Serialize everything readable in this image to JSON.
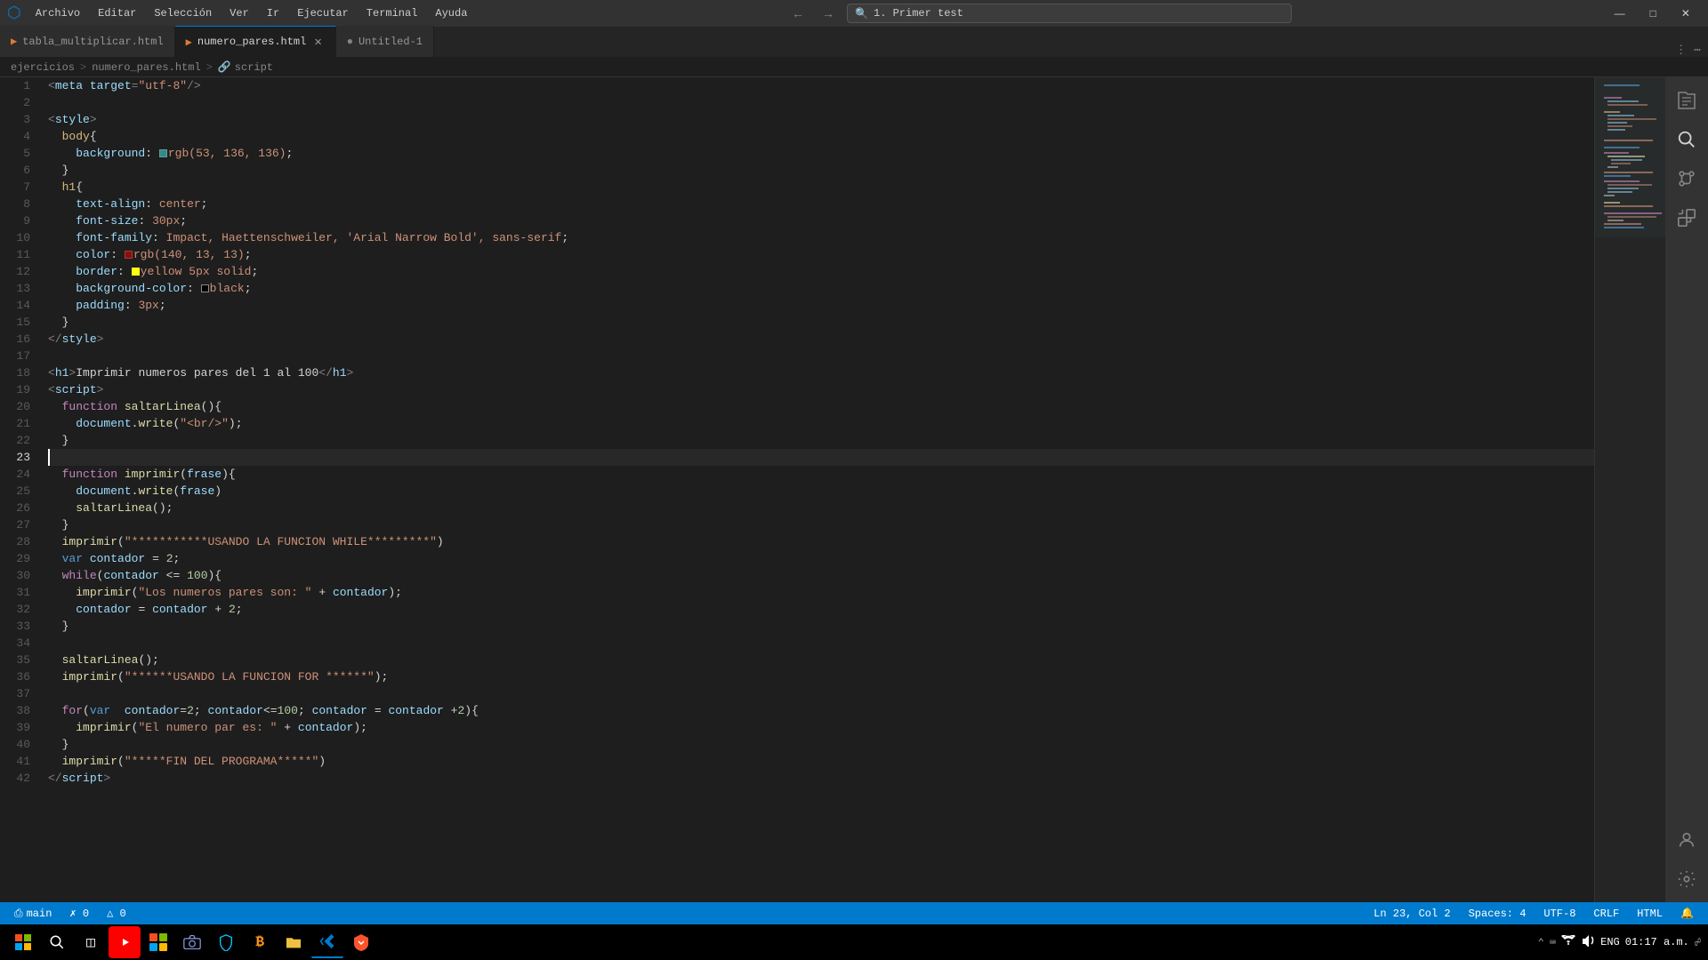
{
  "titlebar": {
    "menu": [
      "Archivo",
      "Editar",
      "Selección",
      "Ver",
      "Ir",
      "Ejecutar",
      "Terminal",
      "Ayuda"
    ],
    "search": "1. Primer test",
    "window_buttons": [
      "—",
      "⬜",
      "✕"
    ]
  },
  "tabs": [
    {
      "id": "tab1",
      "label": "tabla_multiplicar.html",
      "active": false,
      "modified": false
    },
    {
      "id": "tab2",
      "label": "numero_pares.html",
      "active": true,
      "modified": false
    },
    {
      "id": "tab3",
      "label": "Untitled-1",
      "active": false,
      "modified": true
    }
  ],
  "breadcrumb": [
    "ejercicios",
    "numero_pares.html",
    "script"
  ],
  "code_lines": [
    {
      "n": 1,
      "content": "meta_target"
    },
    {
      "n": 2,
      "content": "empty"
    },
    {
      "n": 3,
      "content": "style_open"
    },
    {
      "n": 4,
      "content": "body_open"
    },
    {
      "n": 5,
      "content": "background"
    },
    {
      "n": 6,
      "content": "close_brace"
    },
    {
      "n": 7,
      "content": "h1_open"
    },
    {
      "n": 8,
      "content": "text_align"
    },
    {
      "n": 9,
      "content": "font_size"
    },
    {
      "n": 10,
      "content": "font_family"
    },
    {
      "n": 11,
      "content": "color_line"
    },
    {
      "n": 12,
      "content": "border_line"
    },
    {
      "n": 13,
      "content": "bg_color"
    },
    {
      "n": 14,
      "content": "padding"
    },
    {
      "n": 15,
      "content": "close_brace"
    },
    {
      "n": 16,
      "content": "style_close"
    },
    {
      "n": 17,
      "content": "empty"
    },
    {
      "n": 18,
      "content": "h1_tag"
    },
    {
      "n": 19,
      "content": "script_open"
    },
    {
      "n": 20,
      "content": "fn_saltarLinea"
    },
    {
      "n": 21,
      "content": "doc_write_br"
    },
    {
      "n": 22,
      "content": "close_brace"
    },
    {
      "n": 23,
      "content": "cursor_line"
    },
    {
      "n": 24,
      "content": "fn_imprimir"
    },
    {
      "n": 25,
      "content": "doc_write_frase"
    },
    {
      "n": 26,
      "content": "saltarLinea_call"
    },
    {
      "n": 27,
      "content": "close_brace"
    },
    {
      "n": 28,
      "content": "imprimir_usando"
    },
    {
      "n": 29,
      "content": "var_contador"
    },
    {
      "n": 30,
      "content": "while_loop"
    },
    {
      "n": 31,
      "content": "imprimir_numeros"
    },
    {
      "n": 32,
      "content": "contador_increment"
    },
    {
      "n": 33,
      "content": "close_brace"
    },
    {
      "n": 34,
      "content": "empty"
    },
    {
      "n": 35,
      "content": "saltarLinea_call2"
    },
    {
      "n": 36,
      "content": "imprimir_usando_for"
    },
    {
      "n": 37,
      "content": "empty"
    },
    {
      "n": 38,
      "content": "for_loop"
    },
    {
      "n": 39,
      "content": "imprimir_el_numero"
    },
    {
      "n": 40,
      "content": "close_brace2"
    },
    {
      "n": 41,
      "content": "imprimir_fin"
    },
    {
      "n": 42,
      "content": "script_close"
    }
  ],
  "status": {
    "branch": "main",
    "errors": "0",
    "warnings": "0",
    "line": "Ln 23, Col 2",
    "spaces": "Spaces: 4",
    "encoding": "UTF-8",
    "eol": "CRLF",
    "language": "HTML",
    "feedback": "🔔"
  },
  "taskbar": {
    "time": "01:17 a.m.",
    "language": "ENG"
  }
}
